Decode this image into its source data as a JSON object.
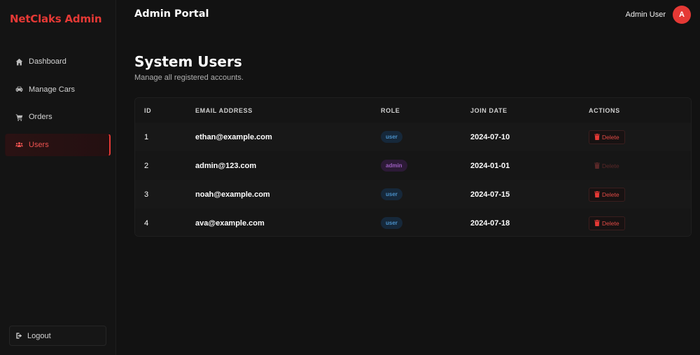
{
  "sidebar": {
    "brand": "NetClaks Admin",
    "items": [
      {
        "label": "Dashboard",
        "icon": "home-icon",
        "active": false
      },
      {
        "label": "Manage Cars",
        "icon": "car-icon",
        "active": false
      },
      {
        "label": "Orders",
        "icon": "cart-icon",
        "active": false
      },
      {
        "label": "Users",
        "icon": "users-icon",
        "active": true
      }
    ],
    "logout_label": "Logout"
  },
  "header": {
    "title": "Admin Portal",
    "user_name": "Admin User",
    "avatar_initial": "A"
  },
  "main": {
    "title": "System Users",
    "subtitle": "Manage all registered accounts.",
    "table": {
      "headers": [
        "ID",
        "EMAIL ADDRESS",
        "ROLE",
        "JOIN DATE",
        "ACTIONS"
      ],
      "rows": [
        {
          "id": "1",
          "email": "ethan@example.com",
          "role": "user",
          "join_date": "2024-07-10",
          "action": "Delete",
          "action_enabled": true
        },
        {
          "id": "2",
          "email": "admin@123.com",
          "role": "admin",
          "join_date": "2024-01-01",
          "action": "Delete",
          "action_enabled": false
        },
        {
          "id": "3",
          "email": "noah@example.com",
          "role": "user",
          "join_date": "2024-07-15",
          "action": "Delete",
          "action_enabled": true
        },
        {
          "id": "4",
          "email": "ava@example.com",
          "role": "user",
          "join_date": "2024-07-18",
          "action": "Delete",
          "action_enabled": true
        }
      ]
    }
  },
  "colors": {
    "accent": "#e53935",
    "background": "#121212",
    "user_badge": "#4a90c8",
    "admin_badge": "#9c5fc0"
  }
}
